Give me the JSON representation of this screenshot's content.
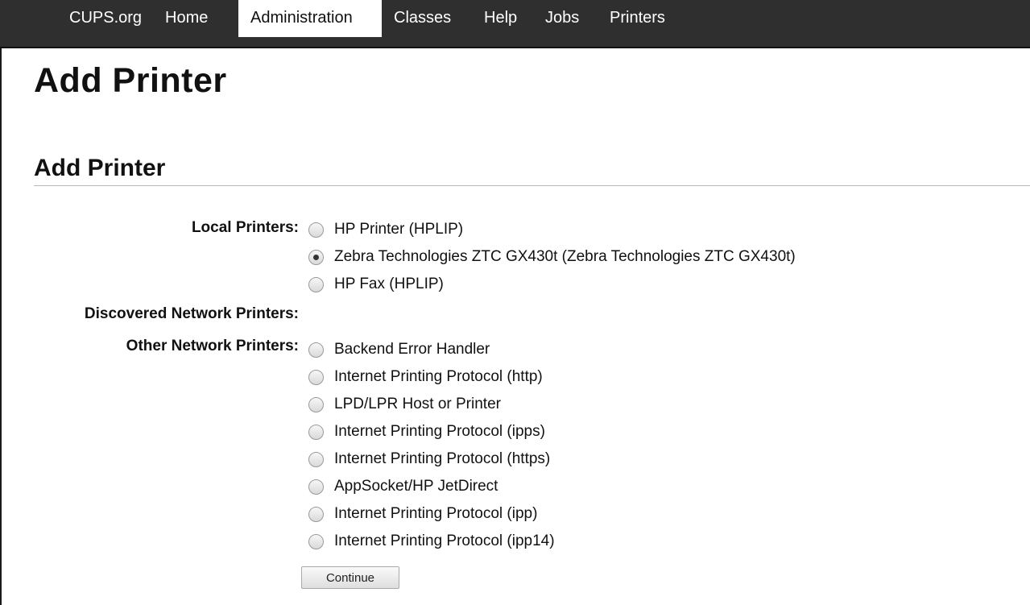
{
  "nav": {
    "items": [
      {
        "label": "CUPS.org"
      },
      {
        "label": "Home"
      },
      {
        "label": "Administration"
      },
      {
        "label": "Classes"
      },
      {
        "label": "Help"
      },
      {
        "label": "Jobs"
      },
      {
        "label": "Printers"
      }
    ],
    "active": "Administration"
  },
  "page_title": "Add Printer",
  "section_title": "Add Printer",
  "groups": {
    "local": {
      "label": "Local Printers:",
      "options": [
        {
          "label": "HP Printer (HPLIP)",
          "selected": false
        },
        {
          "label": "Zebra Technologies ZTC GX430t (Zebra Technologies ZTC GX430t)",
          "selected": true
        },
        {
          "label": "HP Fax (HPLIP)",
          "selected": false
        }
      ]
    },
    "discovered": {
      "label": "Discovered Network Printers:",
      "options": []
    },
    "other": {
      "label": "Other Network Printers:",
      "options": [
        {
          "label": "Backend Error Handler",
          "selected": false
        },
        {
          "label": "Internet Printing Protocol (http)",
          "selected": false
        },
        {
          "label": "LPD/LPR Host or Printer",
          "selected": false
        },
        {
          "label": "Internet Printing Protocol (ipps)",
          "selected": false
        },
        {
          "label": "Internet Printing Protocol (https)",
          "selected": false
        },
        {
          "label": "AppSocket/HP JetDirect",
          "selected": false
        },
        {
          "label": "Internet Printing Protocol (ipp)",
          "selected": false
        },
        {
          "label": "Internet Printing Protocol (ipp14)",
          "selected": false
        }
      ]
    }
  },
  "continue_label": "Continue"
}
